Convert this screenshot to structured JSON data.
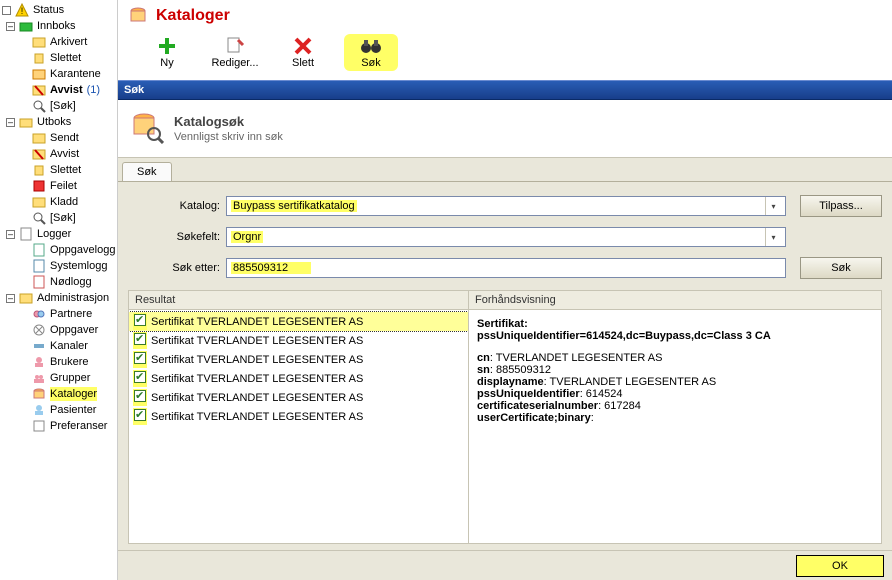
{
  "sidebar": {
    "root": "Status",
    "groups": [
      {
        "label": "Innboks",
        "items": [
          {
            "label": "Arkivert"
          },
          {
            "label": "Slettet"
          },
          {
            "label": "Karantene"
          },
          {
            "label": "Avvist",
            "bold": true,
            "count": "(1)"
          },
          {
            "label": "[Søk]"
          }
        ]
      },
      {
        "label": "Utboks",
        "items": [
          {
            "label": "Sendt"
          },
          {
            "label": "Avvist"
          },
          {
            "label": "Slettet"
          },
          {
            "label": "Feilet"
          },
          {
            "label": "Kladd"
          },
          {
            "label": "[Søk]"
          }
        ]
      },
      {
        "label": "Logger",
        "items": [
          {
            "label": "Oppgavelogg"
          },
          {
            "label": "Systemlogg"
          },
          {
            "label": "Nødlogg"
          }
        ]
      },
      {
        "label": "Administrasjon",
        "items": [
          {
            "label": "Partnere"
          },
          {
            "label": "Oppgaver"
          },
          {
            "label": "Kanaler"
          },
          {
            "label": "Brukere"
          },
          {
            "label": "Grupper"
          },
          {
            "label": "Kataloger",
            "hl": true
          },
          {
            "label": "Pasienter"
          },
          {
            "label": "Preferanser"
          }
        ]
      }
    ]
  },
  "page": {
    "title": "Kataloger",
    "toolbar": [
      {
        "id": "ny",
        "label": "Ny"
      },
      {
        "id": "rediger",
        "label": "Rediger..."
      },
      {
        "id": "slett",
        "label": "Slett"
      },
      {
        "id": "sok",
        "label": "Søk",
        "hl": true
      }
    ]
  },
  "search": {
    "window_title": "Søk",
    "head_title": "Katalogsøk",
    "head_sub": "Vennligst skriv inn søk",
    "tab": "Søk",
    "labels": {
      "katalog": "Katalog:",
      "sokefelt": "Søkefelt:",
      "soketter": "Søk etter:"
    },
    "values": {
      "katalog": "Buypass sertifikatkatalog",
      "sokefelt": "Orgnr",
      "soketter": "885509312"
    },
    "buttons": {
      "tilpass": "Tilpass...",
      "sok": "Søk",
      "ok": "OK"
    },
    "panel_left_title": "Resultat",
    "panel_right_title": "Forhåndsvisning",
    "results": [
      {
        "label": "Sertifikat TVERLANDET LEGESENTER AS",
        "sel": true
      },
      {
        "label": "Sertifikat TVERLANDET LEGESENTER AS"
      },
      {
        "label": "Sertifikat TVERLANDET LEGESENTER AS"
      },
      {
        "label": "Sertifikat TVERLANDET LEGESENTER AS"
      },
      {
        "label": "Sertifikat TVERLANDET LEGESENTER AS"
      },
      {
        "label": "Sertifikat TVERLANDET LEGESENTER AS"
      }
    ],
    "preview": {
      "h": "Sertifikat:",
      "h2": "pssUniqueIdentifier=614524,dc=Buypass,dc=Class 3 CA",
      "cn_l": "cn",
      "cn_v": ": TVERLANDET LEGESENTER AS",
      "sn_l": "sn",
      "sn_v": ": 885509312",
      "dn_l": "displayname",
      "dn_v": ": TVERLANDET LEGESENTER AS",
      "pu_l": "pssUniqueIdentifier",
      "pu_v": ": 614524",
      "cs_l": "certificateserialnumber",
      "cs_v": ": 617284",
      "uc_l": "userCertificate;binary",
      "uc_v": ":"
    }
  }
}
